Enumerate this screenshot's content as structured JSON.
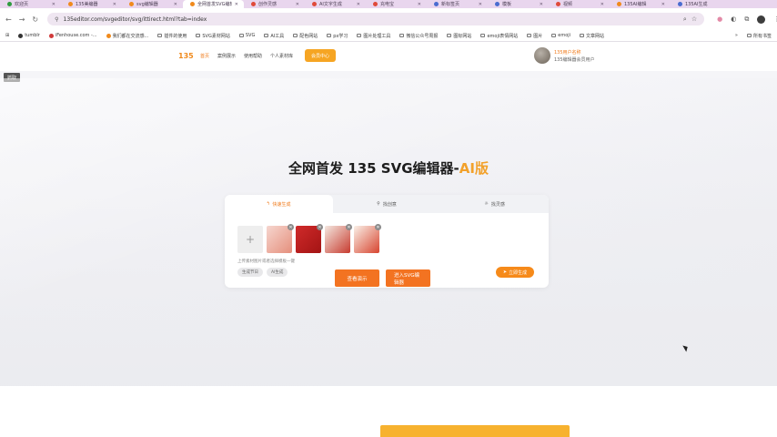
{
  "browser": {
    "tabs": [
      {
        "label": "欢迎页",
        "color": "#2e9b3e"
      },
      {
        "label": "135美编器",
        "color": "#f08a1c"
      },
      {
        "label": "svg编辑器",
        "color": "#f08a1c"
      },
      {
        "label": "全网首发SVG编辑器",
        "color": "#f08a1c",
        "active": true
      },
      {
        "label": "创作灵感",
        "color": "#e04a3a"
      },
      {
        "label": "AI文字生成",
        "color": "#e04a3a"
      },
      {
        "label": "充电宝",
        "color": "#e04a3a"
      },
      {
        "label": "新标签页",
        "color": "#4a6cd0"
      },
      {
        "label": "模板",
        "color": "#4a6cd0"
      },
      {
        "label": "视频",
        "color": "#e04a3a"
      },
      {
        "label": "135AI编辑",
        "color": "#f08a1c"
      },
      {
        "label": "135AI生成",
        "color": "#4a6cd0"
      }
    ],
    "url": "135editor.com/svgeditor/svg/ittirect.html?tab=index",
    "bookmarks": [
      "tumblr",
      "iFenhouse.com -...",
      "我们都在交流感...",
      "插件的使用",
      "SVG素材网站",
      "SVG",
      "AI工具",
      "配色网站",
      "px学习",
      "图片处理工具",
      "微信公众号周报",
      "图标网站",
      "emoji表情网站",
      "图片",
      "emoji",
      "文章网站"
    ],
    "bookmarks_end": "所有书签"
  },
  "site": {
    "logo": "135",
    "nav": [
      "首页",
      "案例展示",
      "使用帮助",
      "个人素材库"
    ],
    "member_button": "会员中心",
    "user_name": "135用户名称",
    "user_info": "135编辑器会员用户"
  },
  "tag": "抓取",
  "hero": {
    "title_main": "全网首发 135 SVG编辑器-",
    "title_ai": "AI版"
  },
  "card": {
    "tabs": [
      "快速生成",
      "找创意",
      "找灵感"
    ],
    "hint": "上传素材图片或者选择模板一键",
    "chips": [
      "生成节日",
      "AI生成"
    ],
    "generate_button": "立即生成"
  },
  "cta": {
    "demo": "查看演示",
    "enter": "进入SVG编辑器"
  }
}
